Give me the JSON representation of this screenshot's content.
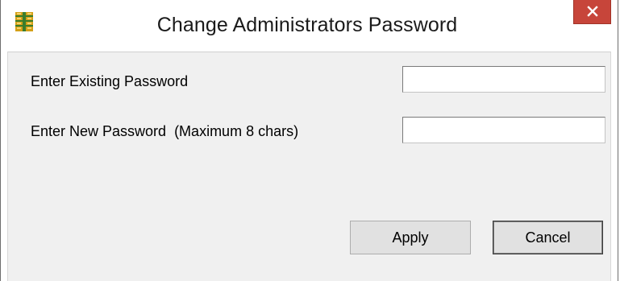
{
  "window": {
    "title": "Change Administrators Password",
    "app_icon": "app-grid-icon",
    "close_icon": "close-icon"
  },
  "form": {
    "existing_label": "Enter Existing Password",
    "existing_value": "",
    "new_label": "Enter New Password  (Maximum 8 chars)",
    "new_value": ""
  },
  "buttons": {
    "apply_label": "Apply",
    "cancel_label": "Cancel"
  },
  "colors": {
    "close_button": "#c7453a",
    "client_background": "#f0f0f0",
    "icon_gold": "#d4a017",
    "icon_green": "#3a7d2c"
  }
}
